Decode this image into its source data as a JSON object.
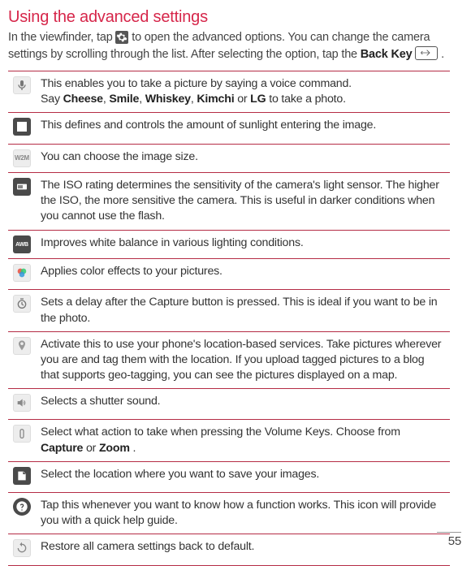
{
  "title": "Using the advanced settings",
  "intro": {
    "part1": "In the viewfinder, tap ",
    "part2": " to open the advanced options. You can change the camera settings by scrolling through the list. After selecting the option, tap the ",
    "backkey_label": "Back Key",
    "part3": " ",
    "part4": "."
  },
  "rows": [
    {
      "icon": "voice-icon",
      "desc_prefix": "This enables you to take a picture by saying a voice command.\nSay ",
      "keywords": [
        "Cheese",
        "Smile",
        "Whiskey",
        "Kimchi"
      ],
      "kw_join": ", ",
      "kw_or": " or ",
      "kw_last": "LG",
      "desc_suffix": " to take a photo."
    },
    {
      "icon": "exposure-icon",
      "desc": "This defines and controls the amount of sunlight entering the image."
    },
    {
      "icon": "size-icon",
      "label": "W2M",
      "desc": "You can choose the image size."
    },
    {
      "icon": "iso-icon",
      "desc": "The ISO rating determines the sensitivity of the camera's light sensor. The higher the ISO, the more sensitive the camera. This is useful in darker conditions when you cannot use the flash."
    },
    {
      "icon": "awb-icon",
      "label": "AWB",
      "desc": "Improves white balance in various lighting conditions."
    },
    {
      "icon": "color-icon",
      "desc": "Applies color effects to your pictures."
    },
    {
      "icon": "timer-icon",
      "desc": "Sets a delay after the Capture button is pressed. This is ideal if you want to be in the photo."
    },
    {
      "icon": "geotag-icon",
      "desc": "Activate this to use your phone's location-based services. Take pictures wherever you are and tag them with the location. If you upload tagged pictures to a blog that supports geo-tagging, you can see the pictures displayed on a map."
    },
    {
      "icon": "shutter-sound-icon",
      "desc": "Selects a shutter sound."
    },
    {
      "icon": "volume-key-icon",
      "desc_prefix": "Select what action to take when pressing the Volume Keys. Choose from ",
      "kw1": "Capture",
      "kw_or": " or ",
      "kw2": "Zoom",
      "desc_suffix": "."
    },
    {
      "icon": "storage-icon",
      "desc": "Select the location where you want to save your images."
    },
    {
      "icon": "help-icon",
      "desc": "Tap this whenever you want to know how a function works. This icon will provide you with a quick help guide."
    },
    {
      "icon": "reset-icon",
      "desc": "Restore all camera settings back to default."
    }
  ],
  "page_number": "55"
}
